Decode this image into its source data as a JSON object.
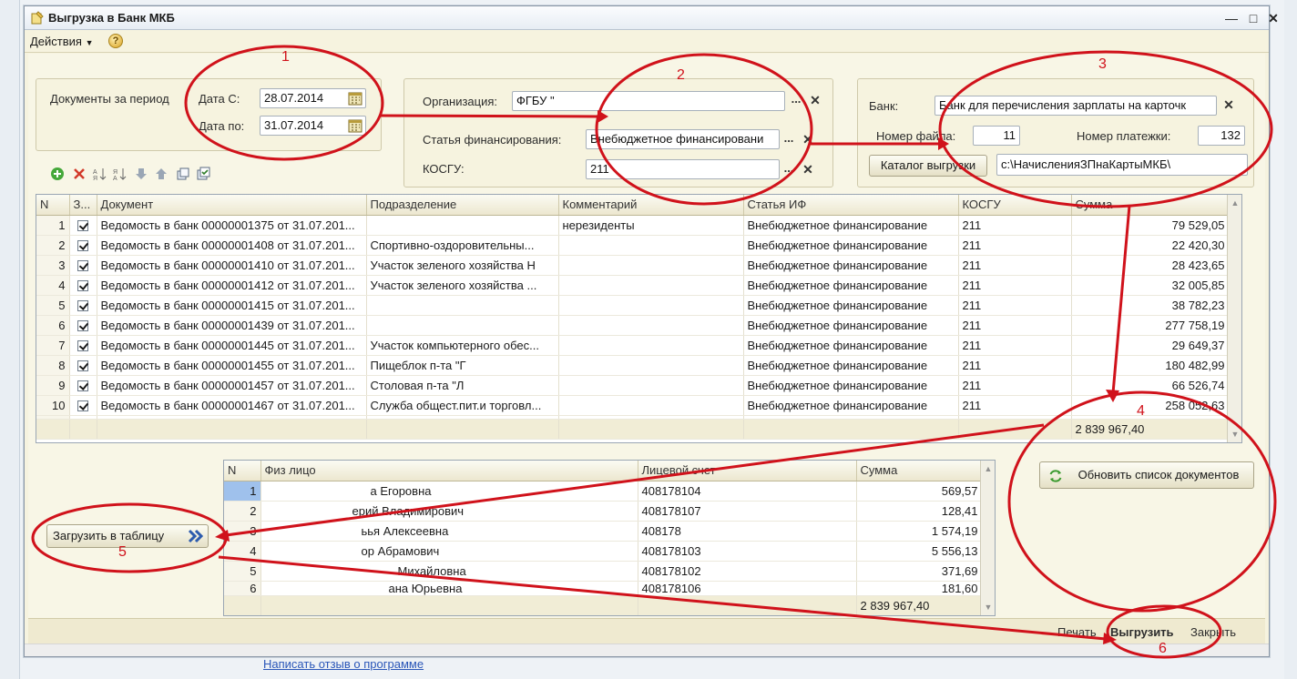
{
  "window": {
    "title": "Выгрузка в Банк МКБ",
    "menu_actions": "Действия",
    "help": "?"
  },
  "period": {
    "group_label": "Документы за период",
    "date_from_label": "Дата С:",
    "date_from": "28.07.2014",
    "date_to_label": "Дата по:",
    "date_to": "31.07.2014"
  },
  "org": {
    "org_label": "Организация:",
    "org_value": "ФГБУ \"",
    "fin_label": "Статья финансирования:",
    "fin_value": "Внебюджетное финансировани",
    "kosgu_label": "КОСГУ:",
    "kosgu_value": "211",
    "select_btn": "...",
    "clear_btn": "✕"
  },
  "bank": {
    "bank_label": "Банк:",
    "bank_value": "Банк для перечисления зарплаты на карточк",
    "file_no_label": "Номер файла:",
    "file_no": "11",
    "payment_no_label": "Номер платежки:",
    "payment_no": "132",
    "catalog_button": "Каталог выгрузки",
    "catalog_path": "c:\\НачисленияЗПнаКартыМКБ\\"
  },
  "docs_table": {
    "headers": [
      "N",
      "З...",
      "Документ",
      "Подразделение",
      "Комментарий",
      "Статья ИФ",
      "КОСГУ",
      "Сумма"
    ],
    "rows": [
      {
        "n": "1",
        "doc": "Ведомость в банк 00000001375 от 31.07.201...",
        "dept": "",
        "comment": "нерезиденты",
        "fin": "Внебюджетное финансирование",
        "kosgu": "211",
        "sum": "79 529,05"
      },
      {
        "n": "2",
        "doc": "Ведомость в банк 00000001408 от 31.07.201...",
        "dept": "Спортивно-оздоровительны...",
        "comment": "",
        "fin": "Внебюджетное финансирование",
        "kosgu": "211",
        "sum": "22 420,30"
      },
      {
        "n": "3",
        "doc": "Ведомость в банк 00000001410 от 31.07.201...",
        "dept": "Участок зеленого хозяйства Н",
        "comment": "",
        "fin": "Внебюджетное финансирование",
        "kosgu": "211",
        "sum": "28 423,65"
      },
      {
        "n": "4",
        "doc": "Ведомость в банк 00000001412 от 31.07.201...",
        "dept": "Участок зеленого хозяйства ...",
        "comment": "",
        "fin": "Внебюджетное финансирование",
        "kosgu": "211",
        "sum": "32 005,85"
      },
      {
        "n": "5",
        "doc": "Ведомость в банк 00000001415 от 31.07.201...",
        "dept": "",
        "comment": "",
        "fin": "Внебюджетное финансирование",
        "kosgu": "211",
        "sum": "38 782,23"
      },
      {
        "n": "6",
        "doc": "Ведомость в банк 00000001439 от 31.07.201...",
        "dept": "",
        "comment": "",
        "fin": "Внебюджетное финансирование",
        "kosgu": "211",
        "sum": "277 758,19"
      },
      {
        "n": "7",
        "doc": "Ведомость в банк 00000001445 от 31.07.201...",
        "dept": "Участок компьютерного обес...",
        "comment": "",
        "fin": "Внебюджетное финансирование",
        "kosgu": "211",
        "sum": "29 649,37"
      },
      {
        "n": "8",
        "doc": "Ведомость в банк 00000001455 от 31.07.201...",
        "dept": "Пищеблок п-та \"Г",
        "comment": "",
        "fin": "Внебюджетное финансирование",
        "kosgu": "211",
        "sum": "180 482,99"
      },
      {
        "n": "9",
        "doc": "Ведомость в банк 00000001457 от 31.07.201...",
        "dept": "Столовая п-та \"Л",
        "comment": "",
        "fin": "Внебюджетное финансирование",
        "kosgu": "211",
        "sum": "66 526,74"
      },
      {
        "n": "10",
        "doc": "Ведомость в банк 00000001467 от 31.07.201...",
        "dept": "Служба общест.пит.и торговл...",
        "comment": "",
        "fin": "Внебюджетное финансирование",
        "kosgu": "211",
        "sum": "258 052,63"
      }
    ],
    "total": "2 839 967,40"
  },
  "refresh_button": "Обновить список документов",
  "load_button": "Загрузить в таблицу",
  "persons_table": {
    "headers": [
      "N",
      "Физ лицо",
      "Лицевой счет",
      "Сумма"
    ],
    "rows": [
      {
        "n": "1",
        "name": "а Егоровна",
        "account": "408178104",
        "sum": "569,57"
      },
      {
        "n": "2",
        "name": "ерий Владимирович",
        "account": "408178107",
        "sum": "128,41"
      },
      {
        "n": "3",
        "name": "ьья Алексеевна",
        "account": "408178",
        "sum": "1 574,19"
      },
      {
        "n": "4",
        "name": "ор Абрамович",
        "account": "408178103",
        "sum": "5 556,13"
      },
      {
        "n": "5",
        "name": "Михайловна",
        "account": "408178102",
        "sum": "371,69"
      },
      {
        "n": "6",
        "name": "ана Юрьевна",
        "account": "408178106",
        "sum": "181,60"
      }
    ],
    "total": "2 839 967,40"
  },
  "footer": {
    "print": "Печать",
    "export": "Выгрузить",
    "close": "Закрыть"
  },
  "feedback_link": "Написать отзыв о программе",
  "annotations": [
    "1",
    "2",
    "3",
    "4",
    "5",
    "6"
  ],
  "annotation_color": "#d0121b"
}
